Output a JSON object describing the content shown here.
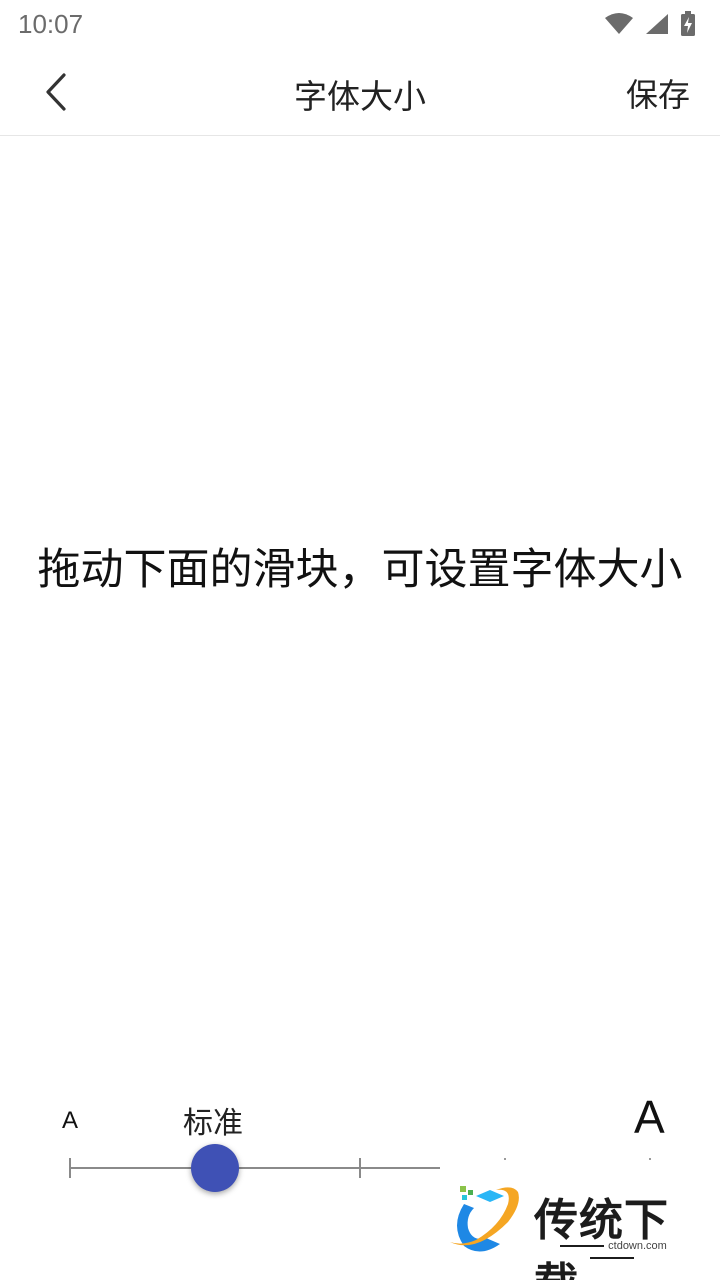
{
  "status_bar": {
    "time": "10:07",
    "icons": [
      "wifi-icon",
      "cell-signal-icon",
      "battery-charging-icon"
    ]
  },
  "toolbar": {
    "back_icon": "chevron-left-icon",
    "title": "字体大小",
    "save_label": "保存"
  },
  "preview": {
    "text": "拖动下面的滑块，可设置字体大小"
  },
  "font_slider": {
    "small_label": "A",
    "large_label": "A",
    "current_label": "标准",
    "steps": 5,
    "current_step": 1,
    "accent_color": "#3f51b5"
  },
  "watermark": {
    "title": "传统下载",
    "subtitle": "ctdown.com"
  }
}
